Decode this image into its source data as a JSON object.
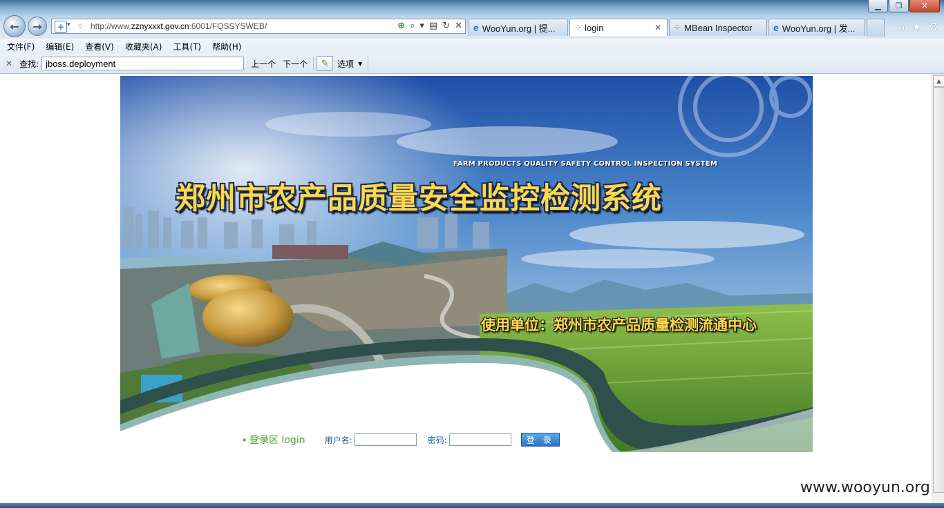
{
  "window": {
    "controls": {
      "minimize": "▁",
      "maximize": "❐",
      "close": "✕"
    }
  },
  "navigation": {
    "back_icon": "back-arrow-icon",
    "forward_icon": "forward-arrow-icon",
    "back_glyph": "←",
    "forward_glyph": "→"
  },
  "address_bar": {
    "url_prefix": "http://www.",
    "url_host": "zznyxxxt.gov.cn",
    "url_suffix": ":6001/FQSSYSWEB/",
    "tools": [
      "⊕",
      "⌕",
      "▾",
      "▤",
      "↻",
      "✕"
    ]
  },
  "tabs": [
    {
      "label": "WooYun.org | 提...",
      "icon": "ie-icon",
      "glyph": "e"
    },
    {
      "label": "login",
      "icon": "loading-icon",
      "glyph": "⁘",
      "active": true,
      "close": "✕"
    },
    {
      "label": "MBean Inspector",
      "icon": "loading-icon",
      "glyph": "⁘"
    },
    {
      "label": "WooYun.org | 发...",
      "icon": "ie-icon",
      "glyph": "e"
    }
  ],
  "chrome_icons": {
    "home": "⌂",
    "favorites": "★",
    "tools": "⚙"
  },
  "menu": [
    "文件(F)",
    "编辑(E)",
    "查看(V)",
    "收藏夹(A)",
    "工具(T)",
    "帮助(H)"
  ],
  "find_bar": {
    "close": "✕",
    "label": "查找:",
    "value": "jboss.deployment",
    "prev": "上一个",
    "next": "下一个",
    "options": "选项",
    "options_arrow": "▼"
  },
  "banner": {
    "subtitle": "FARM PRODUCTS QUALITY SAFETY CONTROL INSPECTION SYSTEM",
    "title": "郑州市农产品质量安全监控检测系统",
    "org": "使用单位：郑州市农产品质量检测流通中心"
  },
  "login": {
    "zone_label": "登录区 login",
    "username_label": "用户名:",
    "username_value": "",
    "password_label": "密码:",
    "password_value": "",
    "submit": "登 录"
  },
  "watermark": "www.wooyun.org"
}
